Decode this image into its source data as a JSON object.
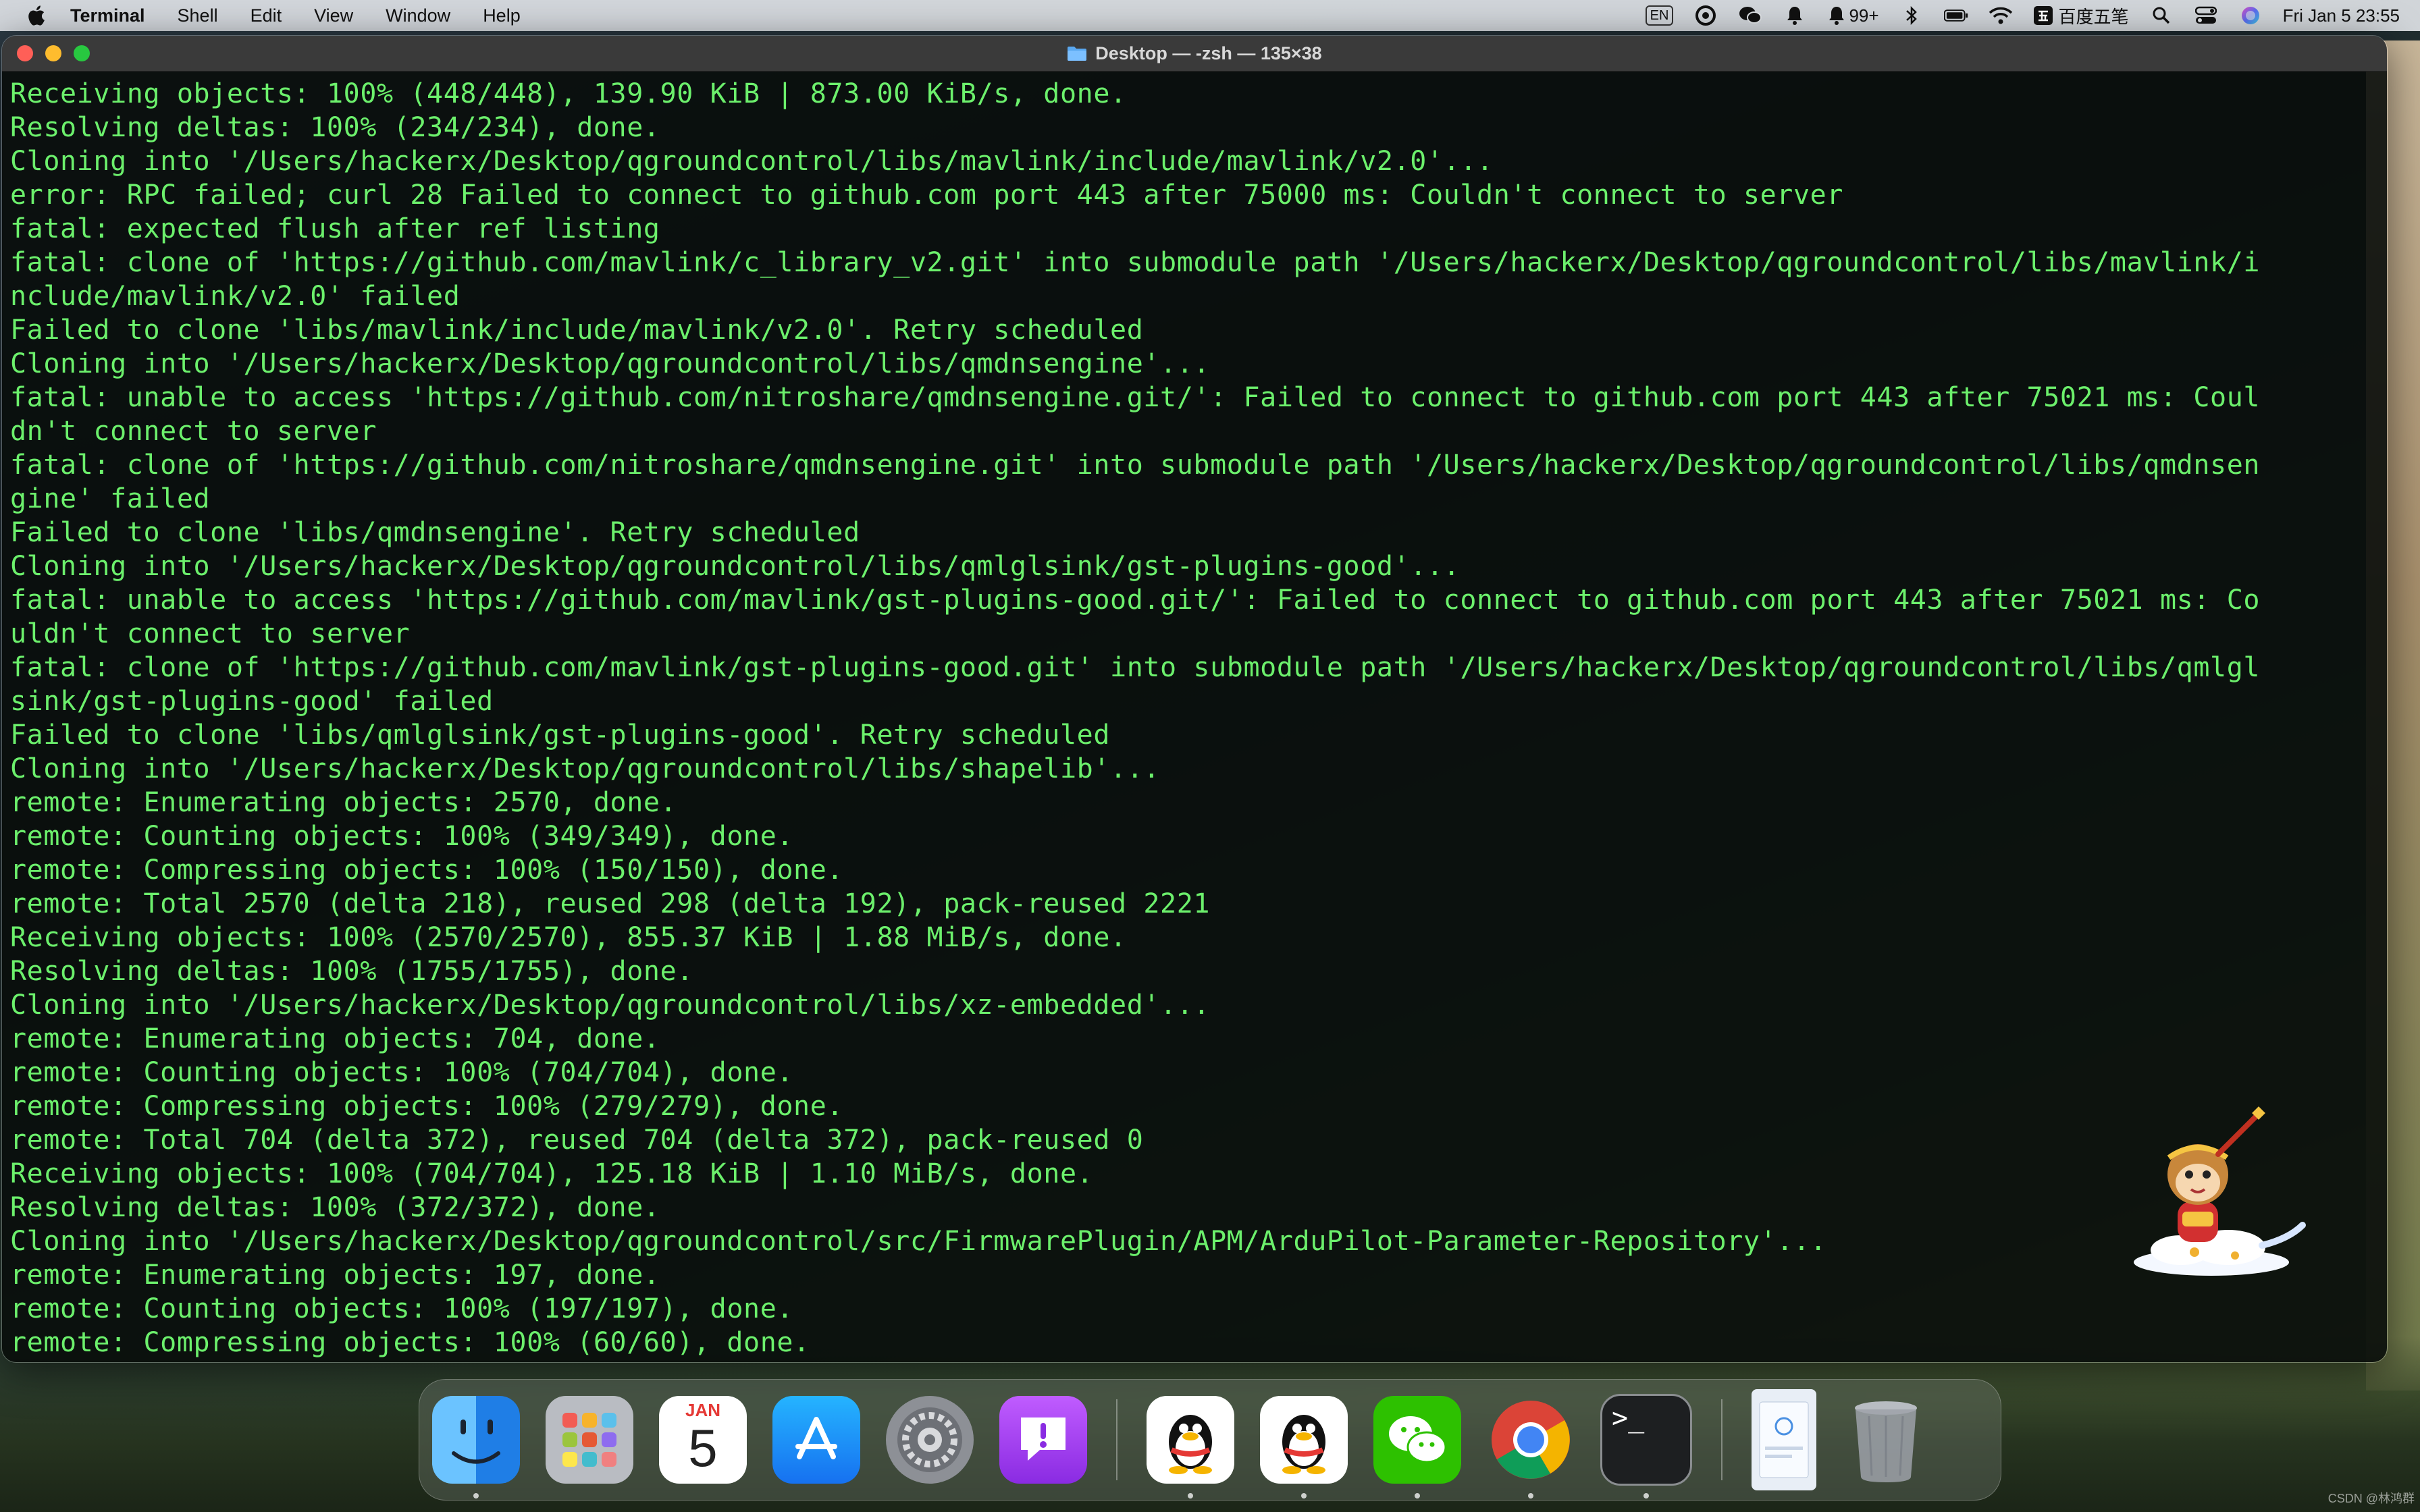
{
  "menubar": {
    "app_name": "Terminal",
    "menus": [
      "Shell",
      "Edit",
      "View",
      "Window",
      "Help"
    ],
    "input_indicator": "EN",
    "notification_count": "99+",
    "ime_label": "百度五笔",
    "datetime": "Fri Jan 5  23:55"
  },
  "window": {
    "title": "Desktop — -zsh — 135×38",
    "lines": [
      "Receiving objects: 100% (448/448), 139.90 KiB | 873.00 KiB/s, done.",
      "Resolving deltas: 100% (234/234), done.",
      "Cloning into '/Users/hackerx/Desktop/qgroundcontrol/libs/mavlink/include/mavlink/v2.0'...",
      "error: RPC failed; curl 28 Failed to connect to github.com port 443 after 75000 ms: Couldn't connect to server",
      "fatal: expected flush after ref listing",
      "fatal: clone of 'https://github.com/mavlink/c_library_v2.git' into submodule path '/Users/hackerx/Desktop/qgroundcontrol/libs/mavlink/i",
      "nclude/mavlink/v2.0' failed",
      "Failed to clone 'libs/mavlink/include/mavlink/v2.0'. Retry scheduled",
      "Cloning into '/Users/hackerx/Desktop/qgroundcontrol/libs/qmdnsengine'...",
      "fatal: unable to access 'https://github.com/nitroshare/qmdnsengine.git/': Failed to connect to github.com port 443 after 75021 ms: Coul",
      "dn't connect to server",
      "fatal: clone of 'https://github.com/nitroshare/qmdnsengine.git' into submodule path '/Users/hackerx/Desktop/qgroundcontrol/libs/qmdnsen",
      "gine' failed",
      "Failed to clone 'libs/qmdnsengine'. Retry scheduled",
      "Cloning into '/Users/hackerx/Desktop/qgroundcontrol/libs/qmlglsink/gst-plugins-good'...",
      "fatal: unable to access 'https://github.com/mavlink/gst-plugins-good.git/': Failed to connect to github.com port 443 after 75021 ms: Co",
      "uldn't connect to server",
      "fatal: clone of 'https://github.com/mavlink/gst-plugins-good.git' into submodule path '/Users/hackerx/Desktop/qgroundcontrol/libs/qmlgl",
      "sink/gst-plugins-good' failed",
      "Failed to clone 'libs/qmlglsink/gst-plugins-good'. Retry scheduled",
      "Cloning into '/Users/hackerx/Desktop/qgroundcontrol/libs/shapelib'...",
      "remote: Enumerating objects: 2570, done.",
      "remote: Counting objects: 100% (349/349), done.",
      "remote: Compressing objects: 100% (150/150), done.",
      "remote: Total 2570 (delta 218), reused 298 (delta 192), pack-reused 2221",
      "Receiving objects: 100% (2570/2570), 855.37 KiB | 1.88 MiB/s, done.",
      "Resolving deltas: 100% (1755/1755), done.",
      "Cloning into '/Users/hackerx/Desktop/qgroundcontrol/libs/xz-embedded'...",
      "remote: Enumerating objects: 704, done.",
      "remote: Counting objects: 100% (704/704), done.",
      "remote: Compressing objects: 100% (279/279), done.",
      "remote: Total 704 (delta 372), reused 704 (delta 372), pack-reused 0",
      "Receiving objects: 100% (704/704), 125.18 KiB | 1.10 MiB/s, done.",
      "Resolving deltas: 100% (372/372), done.",
      "Cloning into '/Users/hackerx/Desktop/qgroundcontrol/src/FirmwarePlugin/APM/ArduPilot-Parameter-Repository'...",
      "remote: Enumerating objects: 197, done.",
      "remote: Counting objects: 100% (197/197), done.",
      "remote: Compressing objects: 100% (60/60), done."
    ]
  },
  "dock": {
    "calendar_month": "JAN",
    "calendar_day": "5",
    "terminal_prompt": ">_"
  },
  "watermark": "CSDN @林鸿群",
  "colors": {
    "terminal_text": "#6cf06c",
    "terminal_bg": "#080c0a"
  }
}
